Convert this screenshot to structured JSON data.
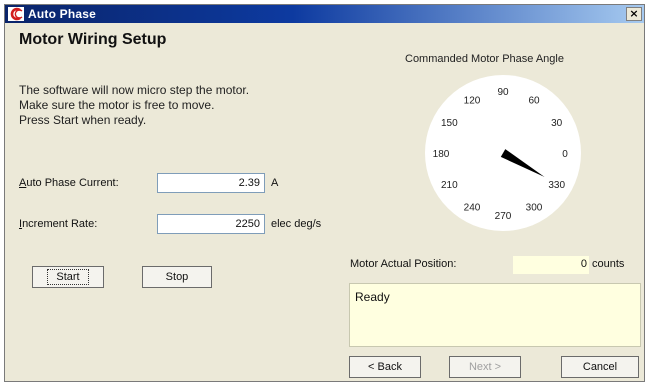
{
  "window": {
    "title": "Auto Phase",
    "close_glyph": "×"
  },
  "heading": "Motor Wiring Setup",
  "instructions": [
    "The software will now micro step the motor.",
    "Make sure the motor is free to move.",
    "Press Start when ready."
  ],
  "fields": {
    "current": {
      "label_key": "A",
      "label_rest": "uto Phase Current:",
      "value": "2.39",
      "unit": "A"
    },
    "rate": {
      "label_key": "I",
      "label_rest": "ncrement Rate:",
      "value": "2250",
      "unit": "elec deg/s"
    }
  },
  "buttons": {
    "start": "Start",
    "stop": "Stop",
    "back": "< Back",
    "next": "Next >",
    "cancel": "Cancel"
  },
  "dial": {
    "title": "Commanded Motor Phase Angle",
    "angle_labels": [
      "0",
      "30",
      "60",
      "90",
      "120",
      "150",
      "180",
      "210",
      "240",
      "270",
      "300",
      "330"
    ],
    "needle_angle_deg": 330,
    "needle_color": "#000000"
  },
  "position": {
    "label": "Motor Actual Position:",
    "value": "0",
    "unit": "counts"
  },
  "status_text": "Ready",
  "colors": {
    "window_bg": "#ece9d8",
    "title_bar": "#0a246a",
    "readonly_bg": "#ffffe0"
  }
}
